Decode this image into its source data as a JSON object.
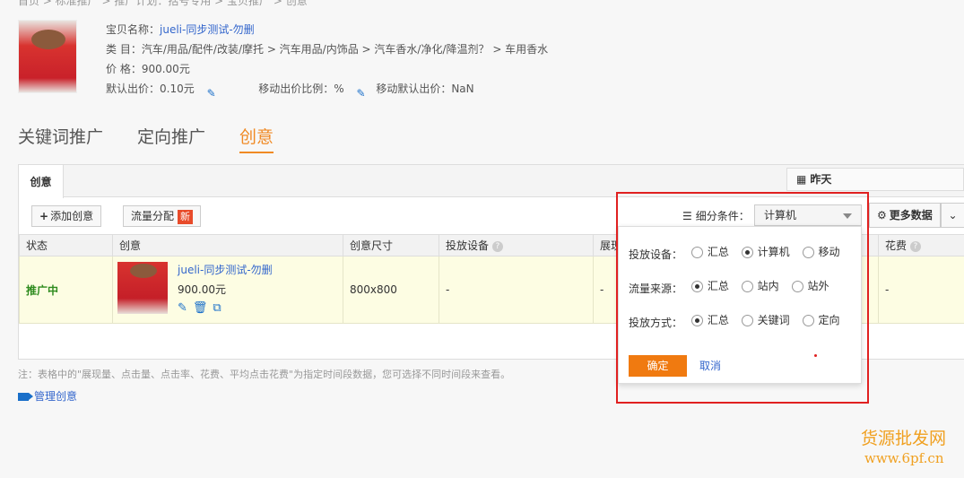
{
  "breadcrumb": "首页  >  标准推广  >  推广计划：括号专用  >  宝贝推广  >  创意",
  "product": {
    "name_label": "宝贝名称：",
    "name": "jueli-同步测试-勿删",
    "category_label": "类      目：",
    "category": "汽车/用品/配件/改装/摩托 > 汽车用品/内饰品 > 汽车香水/净化/降温剂？ > 车用香水",
    "price_label": "价      格：",
    "price": "900.00元",
    "default_bid_label": "默认出价：",
    "default_bid": "0.10元",
    "mobile_ratio_label": "移动出价比例：",
    "mobile_ratio": "%",
    "mobile_default_label": "移动默认出价：",
    "mobile_default": "NaN"
  },
  "main_tabs": [
    "关键词推广",
    "定向推广",
    "创意"
  ],
  "date_box": "昨天",
  "sub_tab": "创意",
  "toolbar": {
    "add_label": "添加创意",
    "flow_label": "流量分配",
    "new_badge": "新",
    "filter_label": "细分条件：",
    "filter_value": "计算机",
    "more_label": "更多数据"
  },
  "table": {
    "headers": [
      "状态",
      "创意",
      "创意尺寸",
      "投放设备",
      "展现量",
      "花费"
    ],
    "row": {
      "status": "推广中",
      "title": "jueli-同步测试-勿删",
      "price": "900.00元",
      "size": "800x800",
      "device": "-",
      "impressions": "-",
      "cost": "-"
    }
  },
  "note": "注：表格中的\"展现量、点击量、点击率、花费、平均点击花费\"为指定时间段数据，您可选择不同时间段来查看。",
  "manage_label": "管理创意",
  "popup": {
    "rows": [
      {
        "label": "投放设备：",
        "options": [
          "汇总",
          "计算机",
          "移动"
        ],
        "selected": 1
      },
      {
        "label": "流量来源：",
        "options": [
          "汇总",
          "站内",
          "站外"
        ],
        "selected": 0
      },
      {
        "label": "投放方式：",
        "options": [
          "汇总",
          "关键词",
          "定向"
        ],
        "selected": 0
      }
    ],
    "ok": "确定",
    "cancel": "取消"
  },
  "watermark": {
    "line1": "货源批发网",
    "line2": "www.6pf.cn"
  },
  "colors": {
    "accent": "#f08a24",
    "link": "#3366cc",
    "status_green": "#2e8b1e",
    "highlight_red": "#e02020"
  }
}
